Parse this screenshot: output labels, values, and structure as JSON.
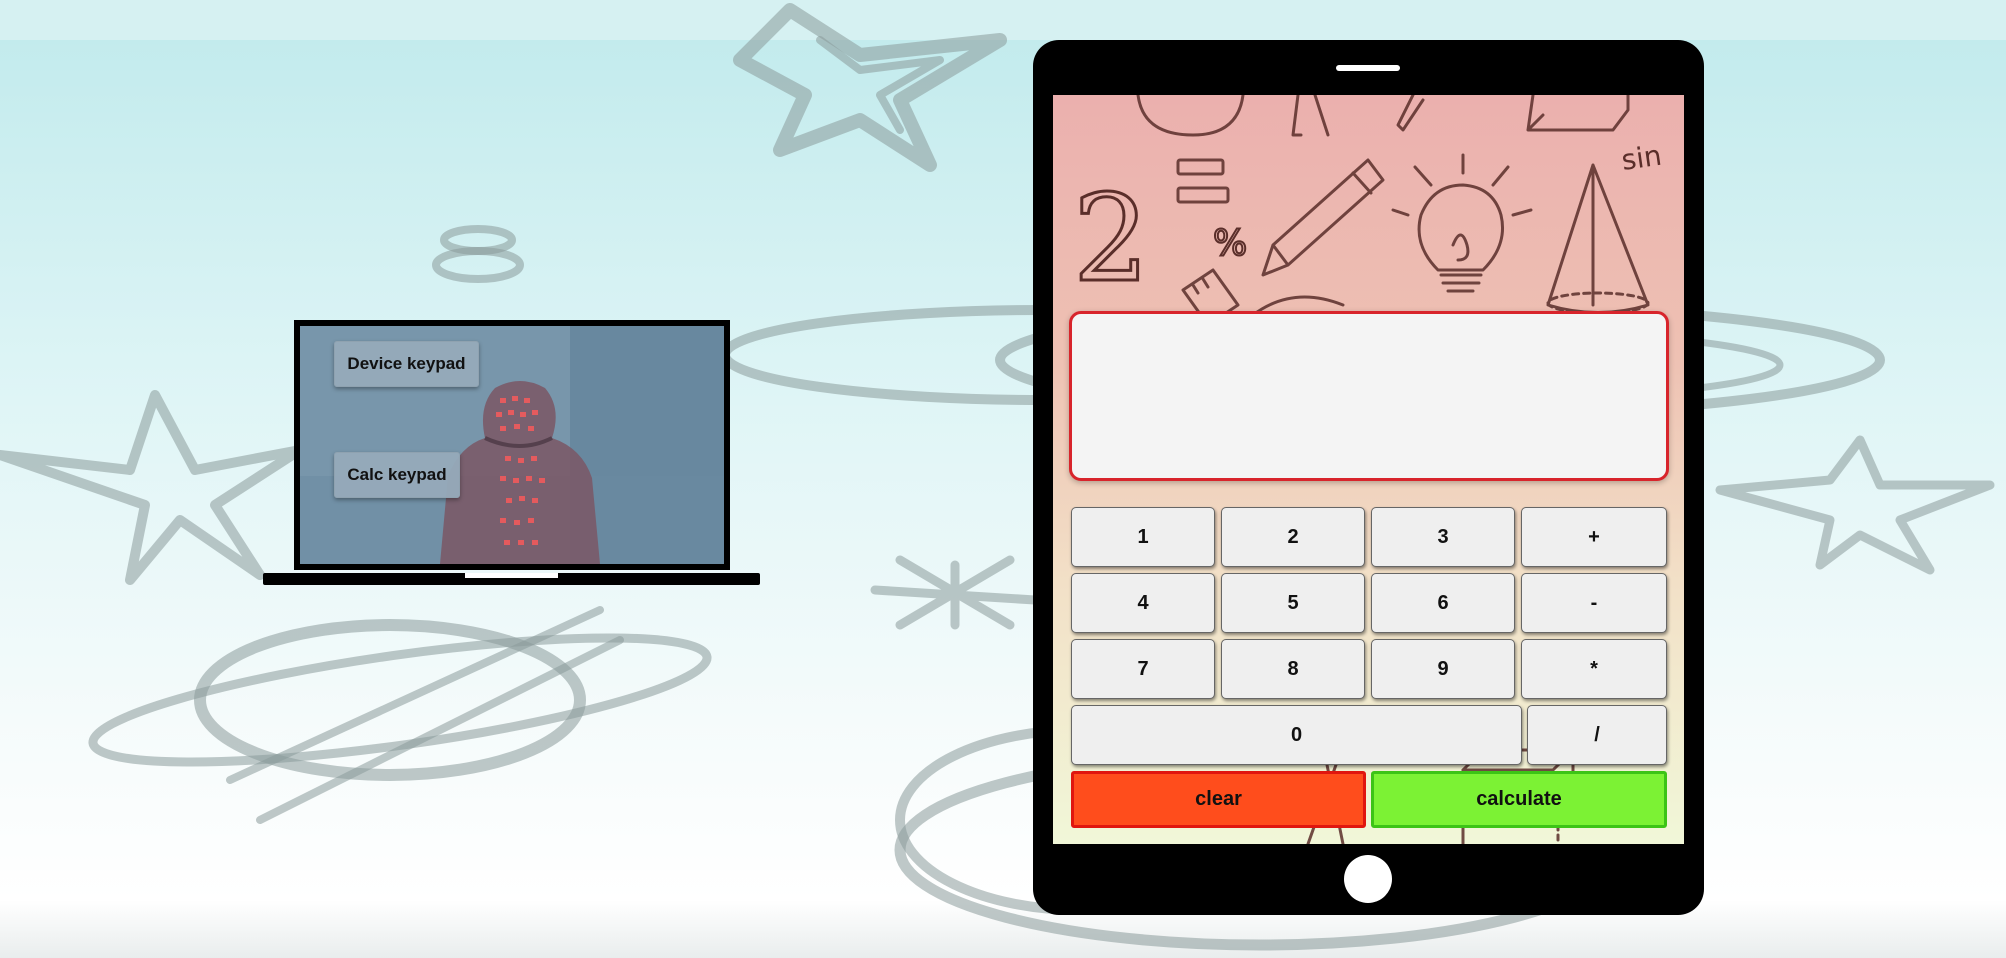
{
  "laptop": {
    "device_keypad_label": "Device keypad",
    "calc_keypad_label": "Calc keypad"
  },
  "calculator": {
    "display_value": "",
    "keys": {
      "k1": "1",
      "k2": "2",
      "k3": "3",
      "plus": "+",
      "k4": "4",
      "k5": "5",
      "k6": "6",
      "minus": "-",
      "k7": "7",
      "k8": "8",
      "k9": "9",
      "multiply": "*",
      "k0": "0",
      "divide": "/"
    },
    "clear_label": "clear",
    "calculate_label": "calculate"
  },
  "doodles": {
    "two": "2",
    "sin": "sin",
    "percent": "%"
  },
  "colors": {
    "clear": "#ff4d1c",
    "calculate": "#7cf234",
    "display_border": "#d8242b"
  }
}
